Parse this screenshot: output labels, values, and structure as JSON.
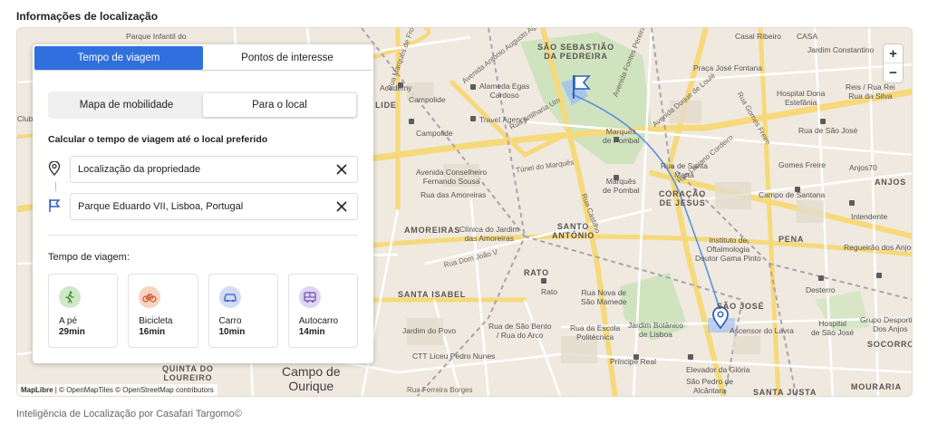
{
  "section_title": "Informações de localização",
  "footer": "Inteligência de Localização por Casafari Targomo©",
  "panel": {
    "tabs": [
      {
        "label": "Tempo de viagem",
        "active": true
      },
      {
        "label": "Pontos de interesse",
        "active": false
      }
    ],
    "segment": [
      {
        "label": "Mapa de mobilidade",
        "active": false
      },
      {
        "label": "Para o local",
        "active": true
      }
    ],
    "calc_title": "Calcular o tempo de viagem até o local preferido",
    "origin": {
      "value": "Localização da propriedade",
      "icon": "map-pin-icon"
    },
    "destination": {
      "value": "Parque Eduardo VII, Lisboa, Portugal",
      "icon": "flag-icon"
    },
    "travel_time_label": "Tempo de viagem:",
    "modes": [
      {
        "name": "A pé",
        "time": "29min",
        "icon": "walking-icon",
        "color": "#cfe9c8",
        "fg": "#3d8a33"
      },
      {
        "name": "Bicicleta",
        "time": "16min",
        "icon": "bicycle-icon",
        "color": "#f7d3c1",
        "fg": "#c7542a"
      },
      {
        "name": "Carro",
        "time": "10min",
        "icon": "car-icon",
        "color": "#d3dcf5",
        "fg": "#3a5bc0"
      },
      {
        "name": "Autocarro",
        "time": "14min",
        "icon": "bus-icon",
        "color": "#ddd5f2",
        "fg": "#6a4fb4"
      }
    ]
  },
  "map": {
    "zoom_in": "+",
    "zoom_out": "−",
    "attribution_brand": "MapLibre",
    "attribution_rest": " | © OpenMapTiles © OpenStreetMap contributors",
    "route_color": "#5b8fe0",
    "labels": {
      "sao_sebastiao": "SÃO SEBASTIÃO\nDA PEDREIRA",
      "alameda": "Alameda Egas\nCardoso",
      "travel_agency": "Travel Agency",
      "marques": "Marquês\nde Pombal",
      "marques2": "Marquês\nde Pombal",
      "rua_santa_marta": "Rua de Santa\nMarta",
      "coracao": "CORAÇÃO\nDE JESUS",
      "santo_antonio": "SANTO\nANTÓNIO",
      "amoreiras": "AMOREIRAS",
      "clinica": "Clínica do Jardim\ndas Amoreiras",
      "rato": "RATO",
      "santa_isabel": "SANTA ISABEL",
      "rato_poi": "Rato",
      "rua_nova": "Rua Nova de\nSão Mamede",
      "sao_bento": "Rua de São Bento\n/ Rua do Arco",
      "jardim_botanico": "Jardim Botânico\nde Lisboa",
      "escola": "Rua da Escola\nPolitécnica",
      "principe_real": "Príncipe Real",
      "elevador": "Elevador da Glória",
      "sao_pedro": "São Pedro de\nAlcântara",
      "santa_justa": "SANTA JUSTA",
      "sao_jose": "SÃO JOSÉ",
      "ascensor": "Ascensor do Lavra",
      "instituto": "Instituto de\nOftalmologia\nDoutor Gama Pinto",
      "pena": "PENA",
      "desterro": "Desterro",
      "hospital_sj": "Hospital\nde São José",
      "grupo_desportivo": "Grupo Desportivo\nDos Anjos",
      "socorro": "SOCORRO",
      "mouraria": "MOURARIA",
      "anjos": "ANJOS",
      "intendente": "Intendente",
      "regueirao": "Regueirão dos Anjos",
      "campo_santana": "Campo de Santana",
      "gomes_freire": "Gomes Freire",
      "rua_sao_jose": "Rua de São José",
      "hospital_estefania": "Hospital Dona\nEstefânia",
      "praca_fontana": "Praça José Fontana",
      "casal_ribeiro": "Casal Ribeiro",
      "casa": "CASA",
      "jardim_constant": "Jardim Constantino",
      "reis": "Reis / Rua Rei\nRua da Silva",
      "anjos70": "Anjos70",
      "campolide": "Campolide",
      "campolide2": "Campolide",
      "lide": "LIDE",
      "academy": "Academy",
      "avenida_conselheiro": "Avenida Conselheiro\nFernando Sousa",
      "rua_amoreiras": "Rua das Amoreiras",
      "tunel": "Túnel do Marquês",
      "parque_infantil": "Parque Infantil do",
      "club": "Club",
      "quinta": "QUINTA DO\nLOUREIRO",
      "campo_ourique": "Campo de\nOurique",
      "ctt": "CTT",
      "liceu": "Liceu Pedro Nunes",
      "jardim_povo": "Jardim do Povo",
      "rua_ferreira": "Rua Ferreira Borges",
      "rua_dom_joao": "Rua Dom João V",
      "avenida_duque": "Avenida Duque de Loulé",
      "rua_luciano": "Rua Luciano Cordeiro",
      "rua_gomes_freire": "Rua Gomes Freire",
      "avenida_fontes": "Avenida Fontes Pereira de Melo",
      "avenida_antonio": "Avenida António Augusto Aguiar",
      "rua_castilho": "Rua Castilho",
      "rua_marques_fronteira": "Rua Marquês de Fronteira",
      "rua_artilharia": "Rua Artilharia Um",
      "rua_sacramento": "Rua do Sacramento à Lapa"
    }
  }
}
